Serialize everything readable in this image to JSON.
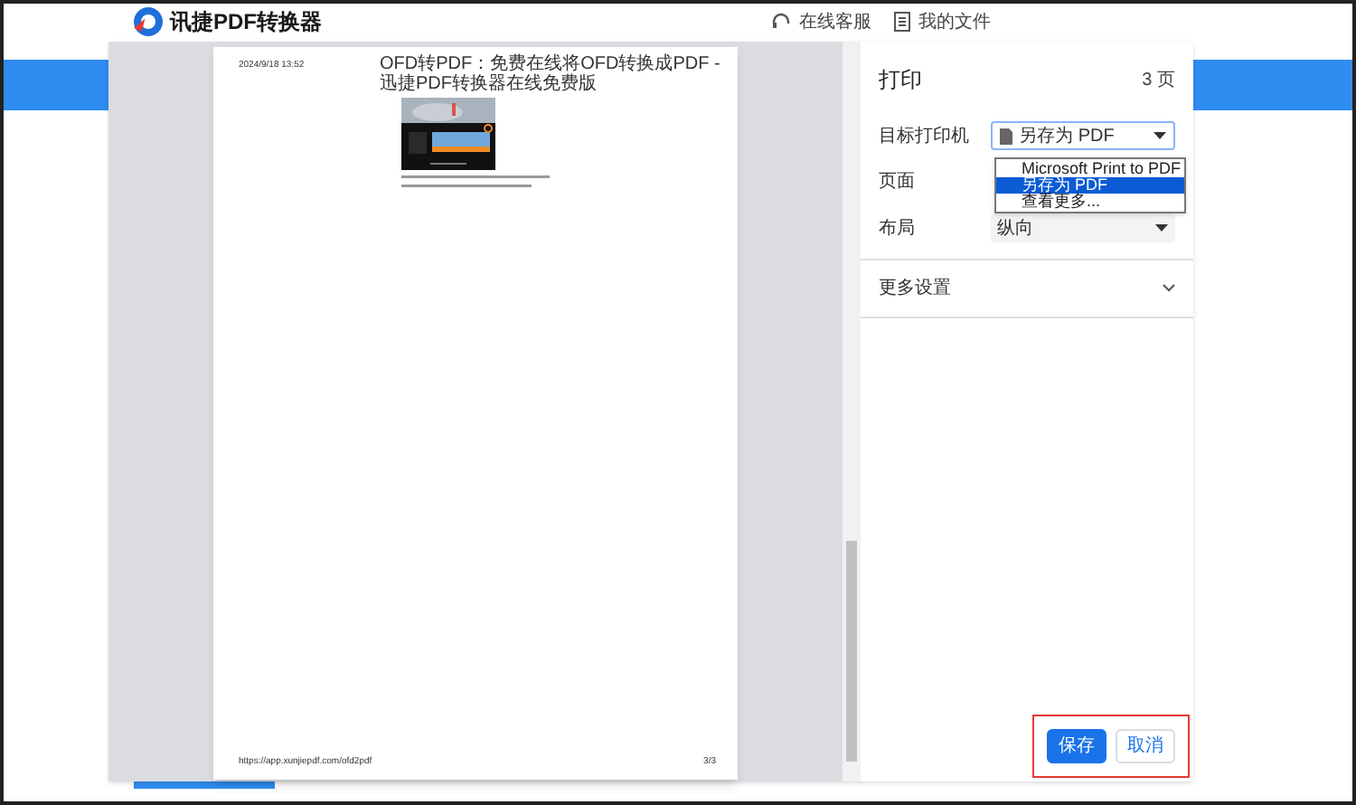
{
  "site_header": {
    "logo_text": "讯捷PDF转换器",
    "links": [
      {
        "kind": "support",
        "label": "在线客服"
      },
      {
        "kind": "files",
        "label": "我的文件"
      }
    ]
  },
  "preview": {
    "date": "2024/9/18 13:52",
    "title": "OFD转PDF：免费在线将OFD转换成PDF - 迅捷PDF转换器在线免费版",
    "url": "https://app.xunjiepdf.com/ofd2pdf",
    "page_number": "3/3"
  },
  "print_panel": {
    "title": "打印",
    "page_count": "3 页",
    "destination": {
      "label": "目标打印机",
      "value": "另存为 PDF",
      "expanded": true,
      "options": [
        {
          "label": "Microsoft Print to PDF",
          "selected": false
        },
        {
          "label": "另存为 PDF",
          "selected": true
        },
        {
          "label": "查看更多...",
          "selected": false
        }
      ]
    },
    "pages_label": "页面",
    "layout": {
      "label": "布局",
      "value": "纵向"
    },
    "more_settings": "更多设置",
    "buttons": [
      {
        "kind": "primary",
        "label": "保存"
      },
      {
        "kind": "secondary",
        "label": "取消"
      }
    ]
  }
}
